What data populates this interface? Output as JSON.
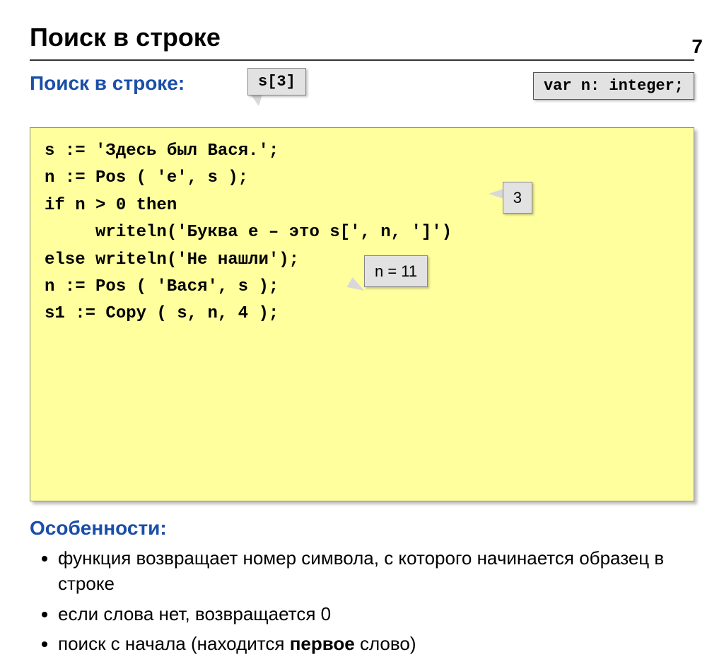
{
  "pageNumber": "7",
  "title": "Поиск в строке",
  "subtitle": "Поиск в строке:",
  "callout_s3": "s[3]",
  "var_decl": "var n: integer;",
  "code": "s := 'Здесь был Вася.';\nn := Pos ( 'е', s );\nif n > 0 then\n     writeln('Буква е – это s[', n, ']')\nelse writeln('Не нашли');\nn := Pos ( 'Вася', s );\ns1 := Copy ( s, n, 4 );",
  "annot_3": "3",
  "annot_n11": "n = 11",
  "featuresTitle": "Особенности:",
  "features": {
    "item1": "функция возвращает номер символа, с которого начинается образец в строке",
    "item2": "если слова нет, возвращается 0",
    "item3_pre": "поиск с начала (находится ",
    "item3_bold": "первое",
    "item3_post": " слово)"
  }
}
